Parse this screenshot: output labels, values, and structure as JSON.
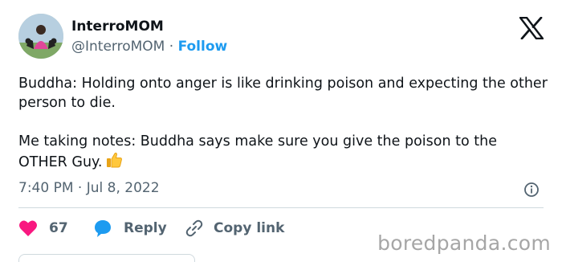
{
  "author": {
    "name": "InterroMOM",
    "handle": "@InterroMOM",
    "separator": "·",
    "follow_label": "Follow"
  },
  "tweet": {
    "line1": "Buddha: Holding onto anger is like drinking poison and expecting the other person to die.",
    "line2": "Me taking notes: Buddha says make sure you give the poison to the OTHER Guy.",
    "emoji": "thumbs-up-emoji",
    "timestamp": "7:40 PM · Jul 8, 2022"
  },
  "actions": {
    "like_count": "67",
    "reply_label": "Reply",
    "copy_label": "Copy link"
  },
  "watermark": "boredpanda.com",
  "colors": {
    "accent": "#1d9bf0",
    "like": "#f91880",
    "text": "#0f1419",
    "muted": "#536471"
  }
}
